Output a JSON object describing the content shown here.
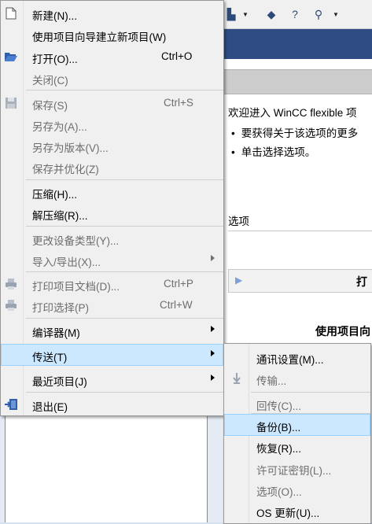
{
  "background": {
    "welcome_text": "欢迎进入 WinCC flexible 项",
    "bullets": [
      "要获得关于该选项的更多",
      "单击选择选项。"
    ],
    "options_label": "选项",
    "box_title": "打",
    "section_title": "使用项目向"
  },
  "menu": {
    "items": [
      {
        "label": "新建(N)...",
        "shortcut": "",
        "disabled": false,
        "submenu": false,
        "icon": "new-file-icon"
      },
      {
        "label": "使用项目向导建立新项目(W)",
        "shortcut": "",
        "disabled": false,
        "submenu": false,
        "icon": ""
      },
      {
        "label": "打开(O)...",
        "shortcut": "Ctrl+O",
        "disabled": false,
        "submenu": false,
        "icon": "open-folder-icon"
      },
      {
        "label": "关闭(C)",
        "shortcut": "",
        "disabled": true,
        "submenu": false,
        "icon": ""
      },
      {
        "label": "保存(S)",
        "shortcut": "Ctrl+S",
        "disabled": true,
        "submenu": false,
        "icon": "save-icon"
      },
      {
        "label": "另存为(A)...",
        "shortcut": "",
        "disabled": true,
        "submenu": false,
        "icon": ""
      },
      {
        "label": "另存为版本(V)...",
        "shortcut": "",
        "disabled": true,
        "submenu": false,
        "icon": ""
      },
      {
        "label": "保存并优化(Z)",
        "shortcut": "",
        "disabled": true,
        "submenu": false,
        "icon": ""
      },
      {
        "label": "压缩(H)...",
        "shortcut": "",
        "disabled": false,
        "submenu": false,
        "icon": ""
      },
      {
        "label": "解压缩(R)...",
        "shortcut": "",
        "disabled": false,
        "submenu": false,
        "icon": ""
      },
      {
        "label": "更改设备类型(Y)...",
        "shortcut": "",
        "disabled": true,
        "submenu": false,
        "icon": ""
      },
      {
        "label": "导入/导出(X)...",
        "shortcut": "",
        "disabled": true,
        "submenu": true,
        "icon": ""
      },
      {
        "label": "打印项目文档(D)...",
        "shortcut": "Ctrl+P",
        "disabled": true,
        "submenu": false,
        "icon": "print-icon"
      },
      {
        "label": "打印选择(P)",
        "shortcut": "Ctrl+W",
        "disabled": true,
        "submenu": false,
        "icon": "print-selection-icon"
      },
      {
        "label": "编译器(M)",
        "shortcut": "",
        "disabled": false,
        "submenu": true,
        "icon": ""
      },
      {
        "label": "传送(T)",
        "shortcut": "",
        "disabled": false,
        "submenu": true,
        "icon": "",
        "highlighted": true
      },
      {
        "label": "最近项目(J)",
        "shortcut": "",
        "disabled": false,
        "submenu": true,
        "icon": ""
      },
      {
        "label": "退出(E)",
        "shortcut": "",
        "disabled": false,
        "submenu": false,
        "icon": "exit-icon"
      }
    ]
  },
  "submenu": {
    "items": [
      {
        "label": "通讯设置(M)...",
        "disabled": false,
        "icon": ""
      },
      {
        "label": "传输...",
        "disabled": true,
        "icon": "transfer-icon"
      },
      {
        "label": "回传(C)...",
        "disabled": true,
        "icon": ""
      },
      {
        "label": "备份(B)...",
        "disabled": false,
        "icon": "",
        "highlighted": true
      },
      {
        "label": "恢复(R)...",
        "disabled": false,
        "icon": ""
      },
      {
        "label": "许可证密钥(L)...",
        "disabled": true,
        "icon": ""
      },
      {
        "label": "选项(O)...",
        "disabled": true,
        "icon": ""
      },
      {
        "label": "OS 更新(U)...",
        "disabled": false,
        "icon": ""
      }
    ]
  },
  "colors": {
    "highlight": "#cce8ff",
    "highlight_border": "#99d1ff",
    "titlebar": "#2f4d84",
    "disabled_text": "#6d6d6d"
  }
}
